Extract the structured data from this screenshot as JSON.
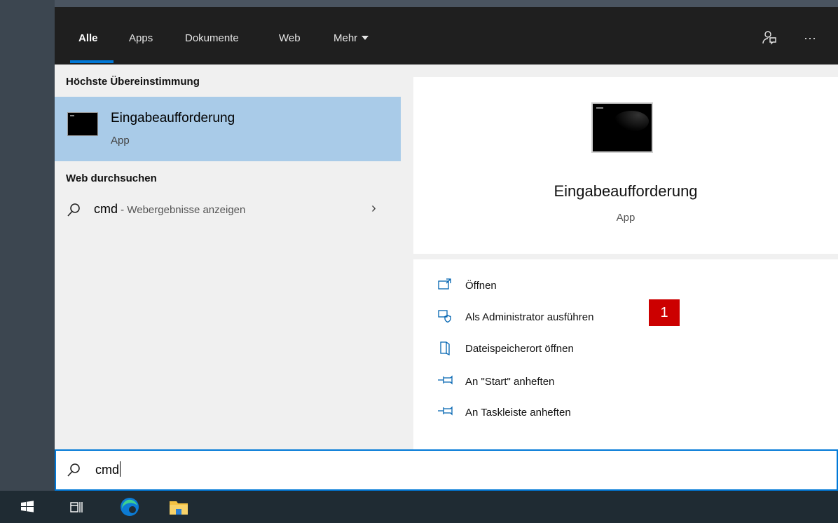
{
  "tabs": [
    {
      "label": "Alle",
      "active": true
    },
    {
      "label": "Apps",
      "active": false
    },
    {
      "label": "Dokumente",
      "active": false
    },
    {
      "label": "Web",
      "active": false
    },
    {
      "label": "Mehr",
      "active": false
    }
  ],
  "topbar_icons": [
    "feedback-icon",
    "more-options-icon"
  ],
  "more_options_label": "···",
  "results": {
    "best_match_heading": "Höchste Übereinstimmung",
    "best_match": {
      "title": "Eingabeaufforderung",
      "subtitle": "App",
      "icon": "command-prompt-icon"
    },
    "web_heading": "Web durchsuchen",
    "web_result": {
      "query": "cmd",
      "hint": " - Webergebnisse anzeigen"
    }
  },
  "preview": {
    "title": "Eingabeaufforderung",
    "subtitle": "App",
    "actions": [
      {
        "label": "Öffnen",
        "icon": "open-window-icon"
      },
      {
        "label": "Als Administrator ausführen",
        "icon": "shield-admin-icon"
      },
      {
        "label": "Dateispeicherort öffnen",
        "icon": "file-location-icon"
      },
      {
        "label": "An \"Start\" anheften",
        "icon": "pin-icon"
      },
      {
        "label": "An Taskleiste anheften",
        "icon": "pin-icon"
      }
    ],
    "step_badge": "1"
  },
  "search": {
    "value": "cmd"
  },
  "taskbar": [
    "windows-start-icon",
    "task-view-icon",
    "edge-browser-icon",
    "file-explorer-icon"
  ],
  "colors": {
    "accent": "#0078d7",
    "selection": "#a9cbe8",
    "badge": "#cc0000",
    "topbar": "#1f1f1f"
  }
}
